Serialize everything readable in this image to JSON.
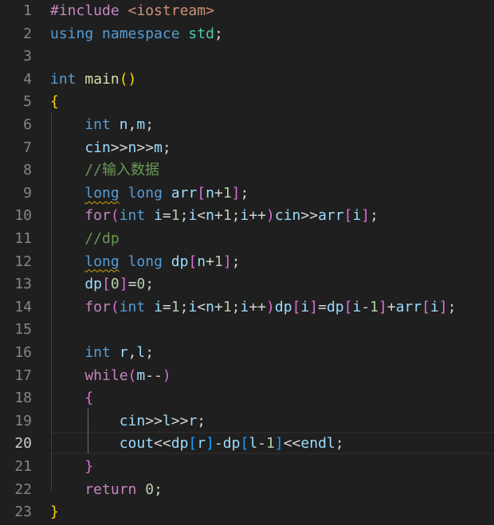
{
  "editor": {
    "lines": [
      {
        "number": "1",
        "tokens": [
          {
            "t": "#include",
            "c": "directive"
          },
          {
            "t": " ",
            "c": "punc"
          },
          {
            "t": "<iostream>",
            "c": "include-path"
          }
        ]
      },
      {
        "number": "2",
        "tokens": [
          {
            "t": "using",
            "c": "keyword"
          },
          {
            "t": " ",
            "c": "punc"
          },
          {
            "t": "namespace",
            "c": "keyword"
          },
          {
            "t": " ",
            "c": "punc"
          },
          {
            "t": "std",
            "c": "ns"
          },
          {
            "t": ";",
            "c": "punc"
          }
        ]
      },
      {
        "number": "3",
        "tokens": []
      },
      {
        "number": "4",
        "tokens": [
          {
            "t": "int",
            "c": "type"
          },
          {
            "t": " ",
            "c": "punc"
          },
          {
            "t": "main",
            "c": "func"
          },
          {
            "t": "()",
            "c": "b1"
          }
        ]
      },
      {
        "number": "5",
        "tokens": [
          {
            "t": "{",
            "c": "b1"
          }
        ]
      },
      {
        "number": "6",
        "tokens": [
          {
            "t": "    int",
            "c": "type"
          },
          {
            "t": " ",
            "c": "punc"
          },
          {
            "t": "n",
            "c": "var"
          },
          {
            "t": ",",
            "c": "punc"
          },
          {
            "t": "m",
            "c": "var"
          },
          {
            "t": ";",
            "c": "punc"
          }
        ]
      },
      {
        "number": "7",
        "tokens": [
          {
            "t": "    cin",
            "c": "var"
          },
          {
            "t": ">>",
            "c": "punc"
          },
          {
            "t": "n",
            "c": "var"
          },
          {
            "t": ">>",
            "c": "punc"
          },
          {
            "t": "m",
            "c": "var"
          },
          {
            "t": ";",
            "c": "punc"
          }
        ]
      },
      {
        "number": "8",
        "tokens": [
          {
            "t": "    //输入数据",
            "c": "comment"
          }
        ]
      },
      {
        "number": "9",
        "tokens": [
          {
            "t": "    ",
            "c": "punc"
          },
          {
            "t": "long",
            "c": "type squiggle"
          },
          {
            "t": " ",
            "c": "punc"
          },
          {
            "t": "long",
            "c": "type"
          },
          {
            "t": " ",
            "c": "punc"
          },
          {
            "t": "arr",
            "c": "var"
          },
          {
            "t": "[",
            "c": "b2"
          },
          {
            "t": "n",
            "c": "var"
          },
          {
            "t": "+",
            "c": "punc"
          },
          {
            "t": "1",
            "c": "num"
          },
          {
            "t": "]",
            "c": "b2"
          },
          {
            "t": ";",
            "c": "punc"
          }
        ]
      },
      {
        "number": "10",
        "tokens": [
          {
            "t": "    for",
            "c": "control"
          },
          {
            "t": "(",
            "c": "b2"
          },
          {
            "t": "int",
            "c": "type"
          },
          {
            "t": " ",
            "c": "punc"
          },
          {
            "t": "i",
            "c": "var"
          },
          {
            "t": "=",
            "c": "punc"
          },
          {
            "t": "1",
            "c": "num"
          },
          {
            "t": ";",
            "c": "punc"
          },
          {
            "t": "i",
            "c": "var"
          },
          {
            "t": "<",
            "c": "punc"
          },
          {
            "t": "n",
            "c": "var"
          },
          {
            "t": "+",
            "c": "punc"
          },
          {
            "t": "1",
            "c": "num"
          },
          {
            "t": ";",
            "c": "punc"
          },
          {
            "t": "i",
            "c": "var"
          },
          {
            "t": "++",
            "c": "punc"
          },
          {
            "t": ")",
            "c": "b2"
          },
          {
            "t": "cin",
            "c": "var"
          },
          {
            "t": ">>",
            "c": "punc"
          },
          {
            "t": "arr",
            "c": "var"
          },
          {
            "t": "[",
            "c": "b2"
          },
          {
            "t": "i",
            "c": "var"
          },
          {
            "t": "]",
            "c": "b2"
          },
          {
            "t": ";",
            "c": "punc"
          }
        ]
      },
      {
        "number": "11",
        "tokens": [
          {
            "t": "    //dp",
            "c": "comment"
          }
        ]
      },
      {
        "number": "12",
        "tokens": [
          {
            "t": "    ",
            "c": "punc"
          },
          {
            "t": "long",
            "c": "type squiggle"
          },
          {
            "t": " ",
            "c": "punc"
          },
          {
            "t": "long",
            "c": "type"
          },
          {
            "t": " ",
            "c": "punc"
          },
          {
            "t": "dp",
            "c": "var"
          },
          {
            "t": "[",
            "c": "b2"
          },
          {
            "t": "n",
            "c": "var"
          },
          {
            "t": "+",
            "c": "punc"
          },
          {
            "t": "1",
            "c": "num"
          },
          {
            "t": "]",
            "c": "b2"
          },
          {
            "t": ";",
            "c": "punc"
          }
        ]
      },
      {
        "number": "13",
        "tokens": [
          {
            "t": "    dp",
            "c": "var"
          },
          {
            "t": "[",
            "c": "b2"
          },
          {
            "t": "0",
            "c": "num"
          },
          {
            "t": "]",
            "c": "b2"
          },
          {
            "t": "=",
            "c": "punc"
          },
          {
            "t": "0",
            "c": "num"
          },
          {
            "t": ";",
            "c": "punc"
          }
        ]
      },
      {
        "number": "14",
        "tokens": [
          {
            "t": "    for",
            "c": "control"
          },
          {
            "t": "(",
            "c": "b2"
          },
          {
            "t": "int",
            "c": "type"
          },
          {
            "t": " ",
            "c": "punc"
          },
          {
            "t": "i",
            "c": "var"
          },
          {
            "t": "=",
            "c": "punc"
          },
          {
            "t": "1",
            "c": "num"
          },
          {
            "t": ";",
            "c": "punc"
          },
          {
            "t": "i",
            "c": "var"
          },
          {
            "t": "<",
            "c": "punc"
          },
          {
            "t": "n",
            "c": "var"
          },
          {
            "t": "+",
            "c": "punc"
          },
          {
            "t": "1",
            "c": "num"
          },
          {
            "t": ";",
            "c": "punc"
          },
          {
            "t": "i",
            "c": "var"
          },
          {
            "t": "++",
            "c": "punc"
          },
          {
            "t": ")",
            "c": "b2"
          },
          {
            "t": "dp",
            "c": "var"
          },
          {
            "t": "[",
            "c": "b2"
          },
          {
            "t": "i",
            "c": "var"
          },
          {
            "t": "]",
            "c": "b2"
          },
          {
            "t": "=",
            "c": "punc"
          },
          {
            "t": "dp",
            "c": "var"
          },
          {
            "t": "[",
            "c": "b2"
          },
          {
            "t": "i",
            "c": "var"
          },
          {
            "t": "-",
            "c": "punc"
          },
          {
            "t": "1",
            "c": "num"
          },
          {
            "t": "]",
            "c": "b2"
          },
          {
            "t": "+",
            "c": "punc"
          },
          {
            "t": "arr",
            "c": "var"
          },
          {
            "t": "[",
            "c": "b2"
          },
          {
            "t": "i",
            "c": "var"
          },
          {
            "t": "]",
            "c": "b2"
          },
          {
            "t": ";",
            "c": "punc"
          }
        ]
      },
      {
        "number": "15",
        "tokens": []
      },
      {
        "number": "16",
        "tokens": [
          {
            "t": "    int",
            "c": "type"
          },
          {
            "t": " ",
            "c": "punc"
          },
          {
            "t": "r",
            "c": "var"
          },
          {
            "t": ",",
            "c": "punc"
          },
          {
            "t": "l",
            "c": "var"
          },
          {
            "t": ";",
            "c": "punc"
          }
        ]
      },
      {
        "number": "17",
        "tokens": [
          {
            "t": "    while",
            "c": "control"
          },
          {
            "t": "(",
            "c": "b2"
          },
          {
            "t": "m",
            "c": "var"
          },
          {
            "t": "--",
            "c": "punc"
          },
          {
            "t": ")",
            "c": "b2"
          }
        ]
      },
      {
        "number": "18",
        "tokens": [
          {
            "t": "    ",
            "c": "punc"
          },
          {
            "t": "{",
            "c": "b2"
          }
        ]
      },
      {
        "number": "19",
        "tokens": [
          {
            "t": "        cin",
            "c": "var"
          },
          {
            "t": ">>",
            "c": "punc"
          },
          {
            "t": "l",
            "c": "var"
          },
          {
            "t": ">>",
            "c": "punc"
          },
          {
            "t": "r",
            "c": "var"
          },
          {
            "t": ";",
            "c": "punc"
          }
        ]
      },
      {
        "number": "20",
        "tokens": [
          {
            "t": "        cout",
            "c": "var"
          },
          {
            "t": "<<",
            "c": "punc"
          },
          {
            "t": "dp",
            "c": "var"
          },
          {
            "t": "[",
            "c": "b3"
          },
          {
            "t": "r",
            "c": "var"
          },
          {
            "t": "]",
            "c": "b3"
          },
          {
            "t": "-",
            "c": "punc"
          },
          {
            "t": "dp",
            "c": "var"
          },
          {
            "t": "[",
            "c": "b3"
          },
          {
            "t": "l",
            "c": "var"
          },
          {
            "t": "-",
            "c": "punc"
          },
          {
            "t": "1",
            "c": "num"
          },
          {
            "t": "]",
            "c": "b3"
          },
          {
            "t": "<<",
            "c": "punc"
          },
          {
            "t": "endl",
            "c": "var"
          },
          {
            "t": ";",
            "c": "punc"
          }
        ]
      },
      {
        "number": "21",
        "tokens": [
          {
            "t": "    ",
            "c": "punc"
          },
          {
            "t": "}",
            "c": "b2"
          }
        ]
      },
      {
        "number": "22",
        "tokens": [
          {
            "t": "    return",
            "c": "control"
          },
          {
            "t": " ",
            "c": "punc"
          },
          {
            "t": "0",
            "c": "num"
          },
          {
            "t": ";",
            "c": "punc"
          }
        ]
      },
      {
        "number": "23",
        "tokens": [
          {
            "t": "}",
            "c": "b1"
          }
        ]
      }
    ],
    "current_line": "20",
    "colors": {
      "background": "#1f1f1f",
      "line_number": "#858585",
      "line_number_active": "#cccccc"
    }
  }
}
